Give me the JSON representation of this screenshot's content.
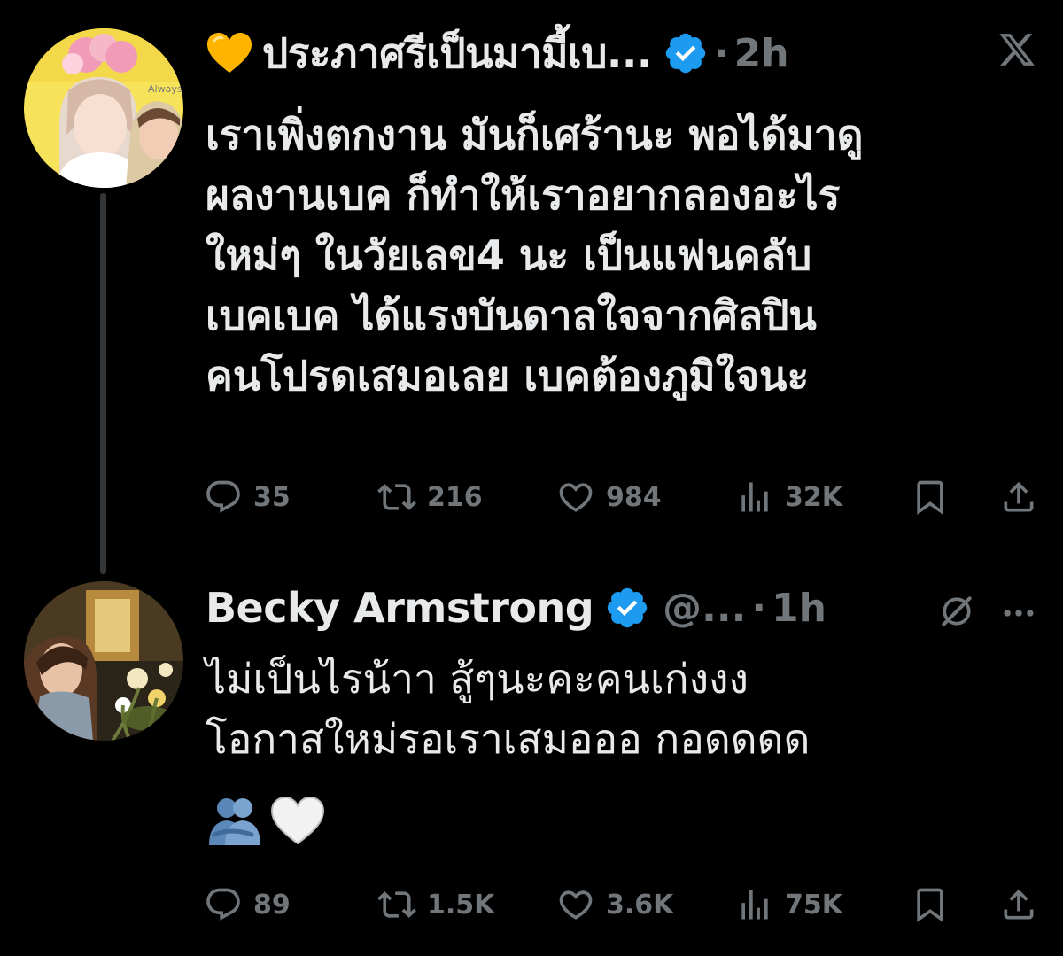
{
  "tweets": [
    {
      "display_name": "ประภาศรีเป็นมามี้เบ...",
      "time": "2h",
      "dot": "·",
      "text": "เราเพิ่งตกงาน มันก็เศร้านะ พอได้มาดู\nผลงานเบค ก็ทำให้เราอยากลองอะไร\nใหม่ๆ ในวัยเลข4 นะ เป็นแฟนคลับ\nเบคเบค ได้แรงบันดาลใจจากศิลปิน\nคนโปรดเสมอเลย เบคต้องภูมิใจนะ",
      "avatar_caption": "Always",
      "stats": {
        "replies": "35",
        "retweets": "216",
        "likes": "984",
        "views": "32K"
      }
    },
    {
      "display_name": "Becky Armstrong",
      "handle": "@...",
      "time": "1h",
      "dot": "·",
      "text": "ไม่เป็นไรน้าา สู้ๆนะคะคนเก่งงง\nโอกาสใหม่รอเราเสมอออ กอดดดด",
      "stats": {
        "replies": "89",
        "retweets": "1.5K",
        "likes": "3.6K",
        "views": "75K"
      }
    }
  ],
  "icons": {
    "heart_emoji": "yellow-heart-emoji",
    "verified": "verified-badge-icon",
    "x_logo": "x-logo-icon",
    "grok": "grok-icon",
    "more": "more-icon",
    "hug_emoji": "people-hugging-emoji",
    "white_heart_emoji": "white-heart-emoji"
  },
  "colors": {
    "background": "#000000",
    "text": "#e7e9ea",
    "muted": "#71767b",
    "verified": "#1d9bf0",
    "thread_line": "#333639"
  }
}
